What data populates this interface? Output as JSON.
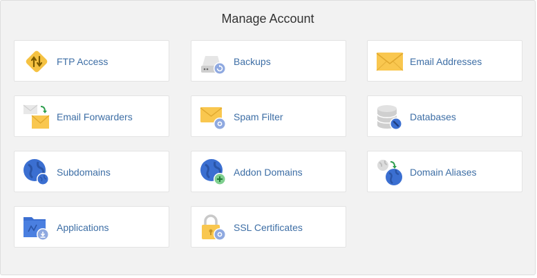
{
  "page": {
    "title": "Manage Account"
  },
  "tiles": [
    {
      "label": "FTP Access",
      "icon": "ftp-icon"
    },
    {
      "label": "Backups",
      "icon": "backups-icon"
    },
    {
      "label": "Email Addresses",
      "icon": "email-icon"
    },
    {
      "label": "Email Forwarders",
      "icon": "email-forwarders-icon"
    },
    {
      "label": "Spam Filter",
      "icon": "spam-filter-icon"
    },
    {
      "label": "Databases",
      "icon": "databases-icon"
    },
    {
      "label": "Subdomains",
      "icon": "subdomains-icon"
    },
    {
      "label": "Addon Domains",
      "icon": "addon-domains-icon"
    },
    {
      "label": "Domain Aliases",
      "icon": "domain-aliases-icon"
    },
    {
      "label": "Applications",
      "icon": "applications-icon"
    },
    {
      "label": "SSL Certificates",
      "icon": "ssl-certificates-icon"
    }
  ],
  "colors": {
    "link": "#3d6ea5",
    "envelope": "#f9c74f",
    "globe": "#3b6fd1",
    "badge": "#8fa9e0",
    "ftp": "#f5c242",
    "disk": "#d7d7d7"
  }
}
